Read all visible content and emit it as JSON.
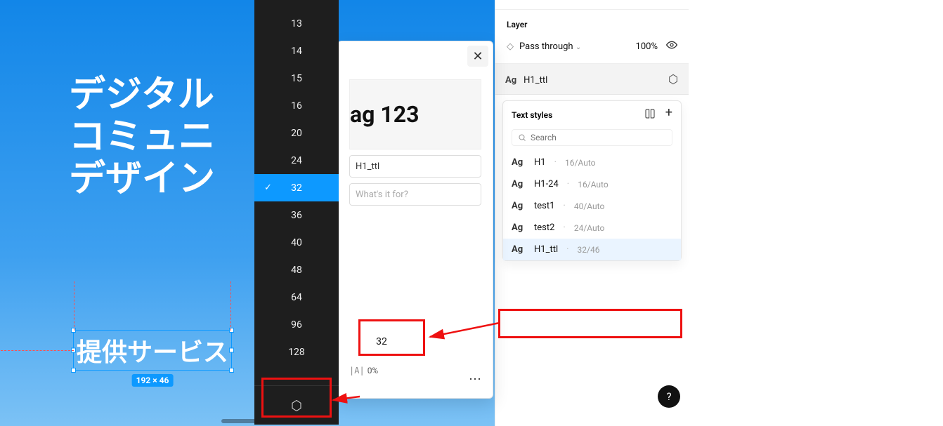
{
  "canvas": {
    "title_lines": "デジタル\nコミュニ\nデザイン",
    "selected_text": "提供サービス",
    "dimensions_badge": "192 × 46"
  },
  "size_dropdown": {
    "options": [
      "13",
      "14",
      "15",
      "16",
      "20",
      "24",
      "32",
      "36",
      "40",
      "48",
      "64",
      "96",
      "128"
    ],
    "selected": "32"
  },
  "popover": {
    "preview_text": "ag 123",
    "name_value": "H1_ttl",
    "desc_placeholder": "What's it for?",
    "size_value": "32",
    "letter_spacing": "0%"
  },
  "inspector": {
    "layer_section_title": "Layer",
    "blend_mode": "Pass through",
    "opacity": "100%",
    "current_style_name": "H1_ttl",
    "styles_panel_title": "Text styles",
    "search_placeholder": "Search",
    "styles": [
      {
        "name": "H1",
        "meta": "16/Auto"
      },
      {
        "name": "H1-24",
        "meta": "16/Auto"
      },
      {
        "name": "test1",
        "meta": "40/Auto"
      },
      {
        "name": "test2",
        "meta": "24/Auto"
      },
      {
        "name": "H1_ttl",
        "meta": "32/46",
        "selected": true
      }
    ]
  },
  "help": {
    "label": "?"
  },
  "annotations": {
    "highlight_color": "#e11"
  }
}
